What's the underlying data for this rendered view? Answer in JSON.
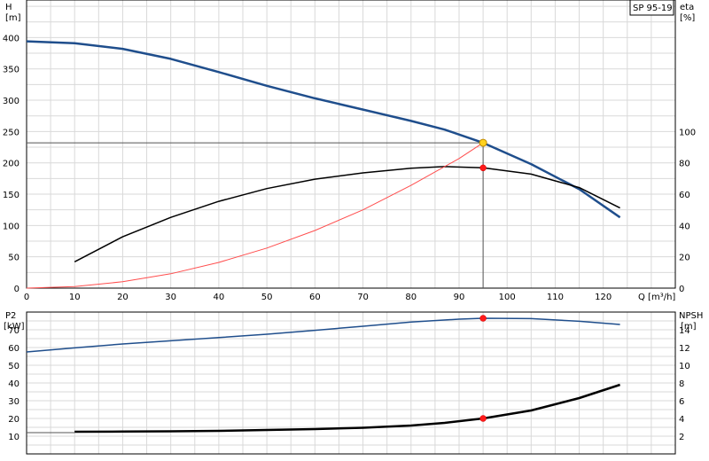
{
  "chart_data": [
    {
      "type": "line",
      "title": "",
      "legend_text": "SP 95-19",
      "xlabel": "Q [m³/h]",
      "ylabel_left": [
        "H",
        "[m]"
      ],
      "ylabel_right": [
        "eta",
        "[%]"
      ],
      "xlim": [
        0,
        135
      ],
      "ylim_left": [
        0,
        460
      ],
      "ylim_right": [
        0,
        184
      ],
      "grid": true,
      "x_ticks": [
        0,
        10,
        20,
        30,
        40,
        50,
        60,
        70,
        80,
        90,
        100,
        110,
        120
      ],
      "y_ticks_left": [
        0,
        50,
        100,
        150,
        200,
        250,
        300,
        350,
        400
      ],
      "y_ticks_right": [
        0,
        20,
        40,
        60,
        80,
        100
      ],
      "series": [
        {
          "name": "",
          "axis": "left",
          "color": "#1f4e8c",
          "width": 2.5,
          "x": [
            0,
            10,
            20,
            30,
            40,
            50,
            60,
            70,
            80,
            87,
            95,
            105,
            115,
            123.5
          ],
          "y": [
            394,
            391,
            382,
            366,
            345,
            323,
            303,
            285,
            267,
            253,
            232,
            198,
            158,
            113
          ]
        },
        {
          "name": "",
          "axis": "right",
          "color": "#000000",
          "width": 1.5,
          "x": [
            10,
            20,
            30,
            40,
            50,
            60,
            70,
            80,
            87,
            95,
            105,
            115,
            123.5
          ],
          "y": [
            16.8,
            32.8,
            45.2,
            55.4,
            63.6,
            69.6,
            73.6,
            76.6,
            77.6,
            76.8,
            72.8,
            64.2,
            51.2
          ]
        },
        {
          "name": "",
          "axis": "left",
          "color": "#ff4d4d",
          "width": 1,
          "x": [
            0,
            10,
            20,
            30,
            40,
            50,
            60,
            70,
            80,
            90,
            95
          ],
          "y": [
            0,
            2.6,
            10.2,
            23,
            41,
            64,
            92,
            125,
            164,
            207,
            232
          ]
        }
      ],
      "duty_point": {
        "x": 95,
        "y": 232,
        "color": "#ffd21f"
      },
      "eta_point": {
        "x": 95,
        "y_percent": 76.8,
        "color": "#ff1a1a"
      },
      "reference_lines": {
        "x": 95,
        "y": 232
      }
    },
    {
      "type": "line",
      "title": "",
      "ylabel_left": [
        "P2",
        "[kW]"
      ],
      "ylabel_right": [
        "NPSH",
        "[m]"
      ],
      "xlim": [
        0,
        135
      ],
      "ylim_left": [
        0,
        80
      ],
      "ylim_right": [
        0,
        16
      ],
      "grid": true,
      "y_ticks_left": [
        10,
        20,
        30,
        40,
        50,
        60,
        70
      ],
      "y_ticks_right": [
        2,
        4,
        6,
        8,
        10,
        12,
        14
      ],
      "series": [
        {
          "name": "",
          "axis": "left",
          "color": "#1f4e8c",
          "width": 1.5,
          "x": [
            0,
            10,
            20,
            30,
            40,
            50,
            60,
            70,
            80,
            90,
            95,
            105,
            115,
            123.5
          ],
          "y": [
            57.5,
            59.8,
            62,
            63.8,
            65.6,
            67.5,
            69.7,
            72,
            74.4,
            76,
            76.5,
            76.3,
            74.8,
            73
          ]
        },
        {
          "name": "",
          "axis": "right",
          "color": "#000000",
          "width": 2.5,
          "x": [
            10,
            20,
            30,
            40,
            50,
            60,
            70,
            80,
            87,
            95,
            105,
            115,
            123.5
          ],
          "y": [
            2.5,
            2.52,
            2.55,
            2.6,
            2.7,
            2.8,
            2.95,
            3.2,
            3.5,
            4,
            4.9,
            6.3,
            7.8
          ]
        }
      ],
      "p2_point": {
        "x": 95,
        "y": 76.5,
        "color": "#ff1a1a"
      },
      "npsh_point": {
        "x": 95,
        "y": 4,
        "color": "#ff1a1a"
      },
      "reference_line_y": 12
    }
  ]
}
